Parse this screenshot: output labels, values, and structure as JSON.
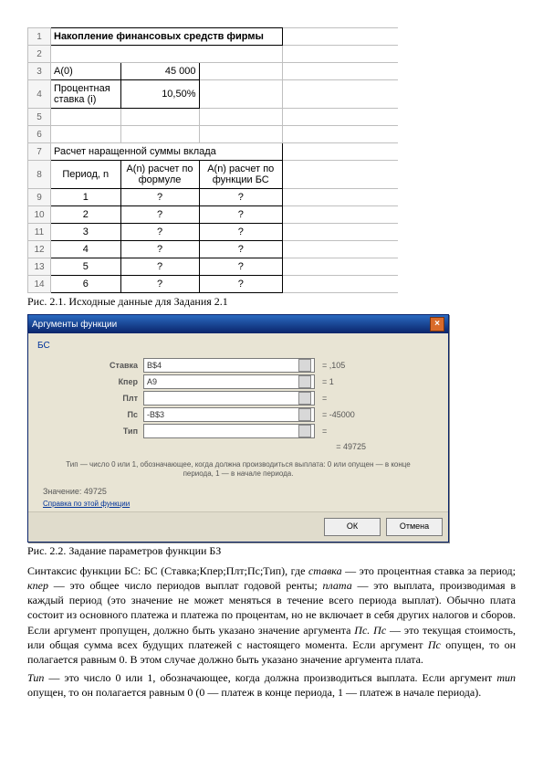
{
  "spreadsheet": {
    "title": "Накопление финансовых средств фирмы",
    "row3": {
      "label": "A(0)",
      "value": "45 000"
    },
    "row4": {
      "label": "Процентная ставка (i)",
      "value": "10,50%"
    },
    "row7": "Расчет наращенной суммы вклада",
    "hdr": {
      "a": "Период, n",
      "b": "A(n) расчет по формуле",
      "c": "A(n) расчет по функции БС"
    },
    "rows": [
      {
        "n": "1",
        "b": "?",
        "c": "?"
      },
      {
        "n": "2",
        "b": "?",
        "c": "?"
      },
      {
        "n": "3",
        "b": "?",
        "c": "?"
      },
      {
        "n": "4",
        "b": "?",
        "c": "?"
      },
      {
        "n": "5",
        "b": "?",
        "c": "?"
      },
      {
        "n": "6",
        "b": "?",
        "c": "?"
      }
    ]
  },
  "caption1": "Рис. 2.1. Исходные данные для Задания 2.1",
  "dialog": {
    "title": "Аргументы функции",
    "fname": "БС",
    "fields": [
      {
        "label": "Ставка",
        "value": "B$4",
        "res": "= ,105"
      },
      {
        "label": "Кпер",
        "value": "A9",
        "res": "= 1"
      },
      {
        "label": "Плт",
        "value": "",
        "res": "="
      },
      {
        "label": "Пс",
        "value": "-B$3",
        "res": "= -45000"
      },
      {
        "label": "Тип",
        "value": "",
        "res": "="
      }
    ],
    "result_eq": "= 49725",
    "tip": "Тип — число 0 или 1, обозначающее, когда должна производиться выплата: 0 или опущен — в конце периода, 1 — в начале периода.",
    "help": "Справка по этой функции",
    "resline": "Значение: 49725",
    "ok": "ОК",
    "cancel": "Отмена"
  },
  "caption2": "Рис. 2.2. Задание параметров функции БЗ",
  "para1_a": "Синтаксис функции БС: БС (Ставка;Кпер;Плт;Пс;Тип), где ",
  "para1_b": " — это процентная ставка за период; ",
  "para1_c": " — это общее число периодов выплат годовой ренты; ",
  "para1_d": " — это выплата, производимая в каждый период (это значение не может меняться в течение всего периода выплат). Обычно плата состоит из основного платежа и платежа по процентам, но не включает в себя других налогов и сборов. Если аргумент пропущен, должно быть указано значение аргумента ",
  "para1_e": " — это текущая стоимость, или общая сумма всех будущих платежей с настоящего момента. Если аргумент ",
  "para1_f": " опущен, то он полагается равным 0. В этом случае должно быть указано значение аргумента плата.",
  "terms": {
    "stavka": "ставка",
    "kper": "кпер",
    "plata": "плата",
    "ps": "Пс",
    "ps2": "Пс. Пс"
  },
  "para2_a": " — это число 0 или 1, обозначающее, когда должна производиться выплата. Если аргумент ",
  "para2_b": " опущен, то он полагается равным 0 (0 — платеж в конце периода, 1 — платеж в начале периода).",
  "terms2": {
    "tip": "Тип",
    "tip2": "тип"
  }
}
